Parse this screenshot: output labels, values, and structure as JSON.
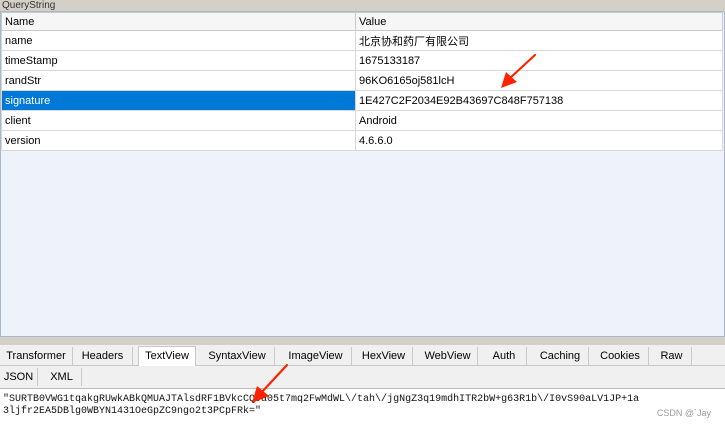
{
  "panel": {
    "title": "QueryString"
  },
  "table": {
    "headers": {
      "name": "Name",
      "value": "Value"
    },
    "rows": [
      {
        "name": "name",
        "value": "北京协和药厂有限公司"
      },
      {
        "name": "timeStamp",
        "value": "1675133187"
      },
      {
        "name": "randStr",
        "value": "96KO6165oj581lcH"
      },
      {
        "name": "signature",
        "value": "1E427C2F2034E92B43697C848F757138",
        "selected": true
      },
      {
        "name": "client",
        "value": "Android"
      },
      {
        "name": "version",
        "value": "4.6.6.0"
      }
    ]
  },
  "tabs_row1": [
    "Transformer",
    "Headers",
    "TextView",
    "SyntaxView",
    "ImageView",
    "HexView",
    "WebView",
    "Auth",
    "Caching",
    "Cookies",
    "Raw"
  ],
  "tabs_row2": [
    "JSON",
    "XML"
  ],
  "active_tab": "TextView",
  "text_view": {
    "content": "\"SURTB0VWG1tqakgRUwkABkQMUAJTAlsdRF1BVkcCQ9a05t7mq2FwMdWL\\/tah\\/jgNgZ3q19mdhITR2bW+g63R1b\\/I0vS90aLV1JP+1a3ljfr2EA5DBlg0WBYN1431OeGpZC9ngo2t3PCpFRk=\""
  },
  "watermark": "CSDN @`Jay",
  "colors": {
    "selection": "#0078d7",
    "arrow": "#ff2200"
  }
}
